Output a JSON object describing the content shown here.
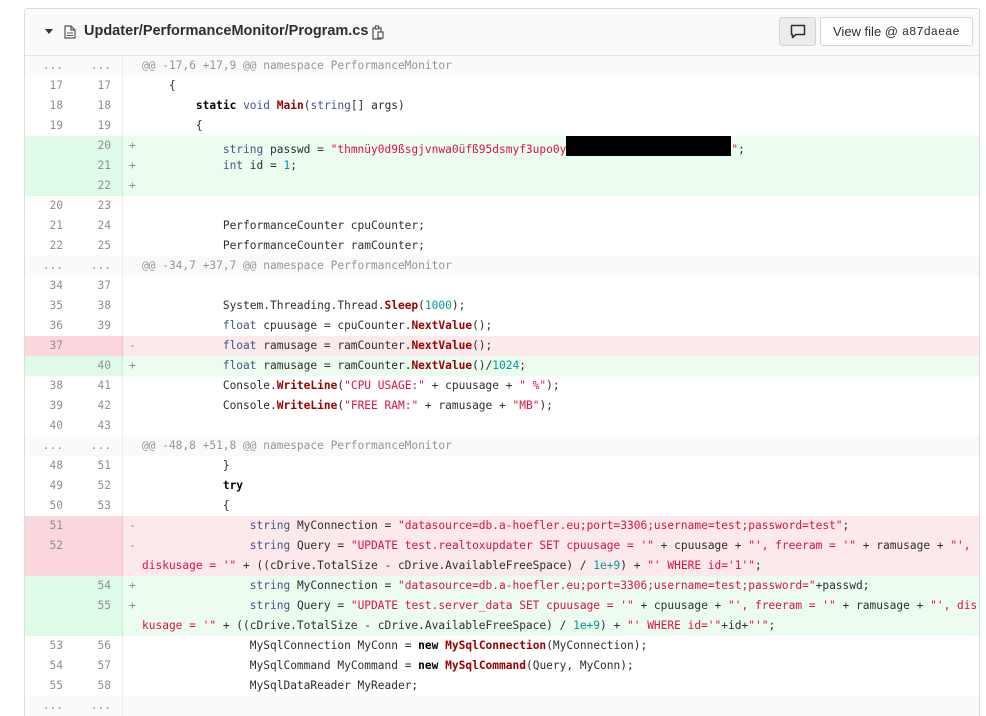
{
  "file": {
    "path": "Updater/PerformanceMonitor/Program.cs",
    "view_file_label": "View file @",
    "commit": "a87daeae"
  },
  "lines": [
    {
      "type": "hunk",
      "old": "...",
      "new": "...",
      "text": "@@ -17,6 +17,9 @@ namespace PerformanceMonitor"
    },
    {
      "type": "ctx",
      "old": "17",
      "new": "17",
      "text": "    {"
    },
    {
      "type": "ctx",
      "old": "18",
      "new": "18",
      "text": "        static void Main(string[] args)"
    },
    {
      "type": "ctx",
      "old": "19",
      "new": "19",
      "text": "        {"
    },
    {
      "type": "add",
      "old": "",
      "new": "20",
      "sign": "+",
      "text": "            string passwd = \"thmnüy0d9ßsgjvnwa0üfß95dsmyf3upo0y\";"
    },
    {
      "type": "add",
      "old": "",
      "new": "21",
      "sign": "+",
      "text": "            int id = 1;"
    },
    {
      "type": "add",
      "old": "",
      "new": "22",
      "sign": "+",
      "text": ""
    },
    {
      "type": "ctx",
      "old": "20",
      "new": "23",
      "text": ""
    },
    {
      "type": "ctx",
      "old": "21",
      "new": "24",
      "text": "            PerformanceCounter cpuCounter;"
    },
    {
      "type": "ctx",
      "old": "22",
      "new": "25",
      "text": "            PerformanceCounter ramCounter;"
    },
    {
      "type": "hunk",
      "old": "...",
      "new": "...",
      "text": "@@ -34,7 +37,7 @@ namespace PerformanceMonitor"
    },
    {
      "type": "ctx",
      "old": "34",
      "new": "37",
      "text": ""
    },
    {
      "type": "ctx",
      "old": "35",
      "new": "38",
      "text": "            System.Threading.Thread.Sleep(1000);"
    },
    {
      "type": "ctx",
      "old": "36",
      "new": "39",
      "text": "            float cpuusage = cpuCounter.NextValue();"
    },
    {
      "type": "del",
      "old": "37",
      "new": "",
      "sign": "-",
      "text": "            float ramusage = ramCounter.NextValue();"
    },
    {
      "type": "add",
      "old": "",
      "new": "40",
      "sign": "+",
      "text": "            float ramusage = ramCounter.NextValue()/1024;"
    },
    {
      "type": "ctx",
      "old": "38",
      "new": "41",
      "text": "            Console.WriteLine(\"CPU USAGE:\" + cpuusage + \" %\");"
    },
    {
      "type": "ctx",
      "old": "39",
      "new": "42",
      "text": "            Console.WriteLine(\"FREE RAM:\" + ramusage + \"MB\");"
    },
    {
      "type": "ctx",
      "old": "40",
      "new": "43",
      "text": ""
    },
    {
      "type": "hunk",
      "old": "...",
      "new": "...",
      "text": "@@ -48,8 +51,8 @@ namespace PerformanceMonitor"
    },
    {
      "type": "ctx",
      "old": "48",
      "new": "51",
      "text": "            }"
    },
    {
      "type": "ctx",
      "old": "49",
      "new": "52",
      "text": "            try"
    },
    {
      "type": "ctx",
      "old": "50",
      "new": "53",
      "text": "            {"
    },
    {
      "type": "del",
      "old": "51",
      "new": "",
      "sign": "-",
      "text": "                string MyConnection = \"datasource=db.a-hoefler.eu;port=3306;username=test;password=test\";"
    },
    {
      "type": "del",
      "old": "52",
      "new": "",
      "sign": "-",
      "tall": true,
      "text": "                string Query = \"UPDATE test.realtoxupdater SET cpuusage = '\" + cpuusage + \"', freeram = '\" + ramusage + \"', diskusage = '\" + ((cDrive.TotalSize - cDrive.AvailableFreeSpace) / 1e+9) + \"' WHERE id='1'\";"
    },
    {
      "type": "add",
      "old": "",
      "new": "54",
      "sign": "+",
      "text": "                string MyConnection = \"datasource=db.a-hoefler.eu;port=3306;username=test;password=\"+passwd;"
    },
    {
      "type": "add",
      "old": "",
      "new": "55",
      "sign": "+",
      "tall": true,
      "text": "                string Query = \"UPDATE test.server_data SET cpuusage = '\" + cpuusage + \"', freeram = '\" + ramusage + \"', diskusage = '\" + ((cDrive.TotalSize - cDrive.AvailableFreeSpace) / 1e+9) + \"' WHERE id='\"+id+\"'\";"
    },
    {
      "type": "ctx",
      "old": "53",
      "new": "56",
      "text": "                MySqlConnection MyConn = new MySqlConnection(MyConnection);"
    },
    {
      "type": "ctx",
      "old": "54",
      "new": "57",
      "text": "                MySqlCommand MyCommand = new MySqlCommand(Query, MyConn);"
    },
    {
      "type": "ctx",
      "old": "55",
      "new": "58",
      "text": "                MySqlDataReader MyReader;"
    },
    {
      "type": "hunk",
      "old": "...",
      "new": "...",
      "text": ""
    }
  ]
}
